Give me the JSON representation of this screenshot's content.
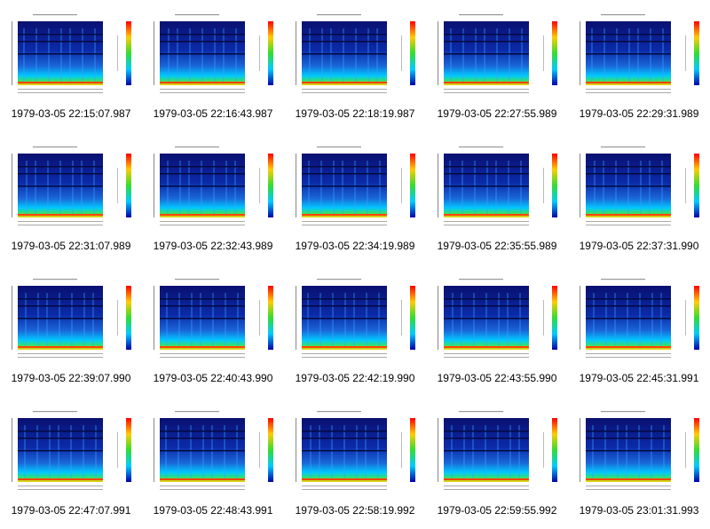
{
  "gallery": {
    "colors": {
      "spectrogram_bg": "#0a1a88",
      "spectrogram_low": "#00c8ff",
      "spectrogram_hot": "#ffcc00",
      "band": "#ff4400"
    },
    "items": [
      {
        "caption": "1979-03-05 22:15:07.987"
      },
      {
        "caption": "1979-03-05 22:16:43.987"
      },
      {
        "caption": "1979-03-05 22:18:19.987"
      },
      {
        "caption": "1979-03-05 22:27:55.989"
      },
      {
        "caption": "1979-03-05 22:29:31.989"
      },
      {
        "caption": "1979-03-05 22:31:07.989"
      },
      {
        "caption": "1979-03-05 22:32:43.989"
      },
      {
        "caption": "1979-03-05 22:34:19.989"
      },
      {
        "caption": "1979-03-05 22:35:55.989"
      },
      {
        "caption": "1979-03-05 22:37:31.990"
      },
      {
        "caption": "1979-03-05 22:39:07.990"
      },
      {
        "caption": "1979-03-05 22:40:43.990"
      },
      {
        "caption": "1979-03-05 22:42:19.990"
      },
      {
        "caption": "1979-03-05 22:43:55.990"
      },
      {
        "caption": "1979-03-05 22:45:31.991"
      },
      {
        "caption": "1979-03-05 22:47:07.991"
      },
      {
        "caption": "1979-03-05 22:48:43.991"
      },
      {
        "caption": "1979-03-05 22:58:19.992"
      },
      {
        "caption": "1979-03-05 22:59:55.992"
      },
      {
        "caption": "1979-03-05 23:01:31.993"
      }
    ]
  }
}
